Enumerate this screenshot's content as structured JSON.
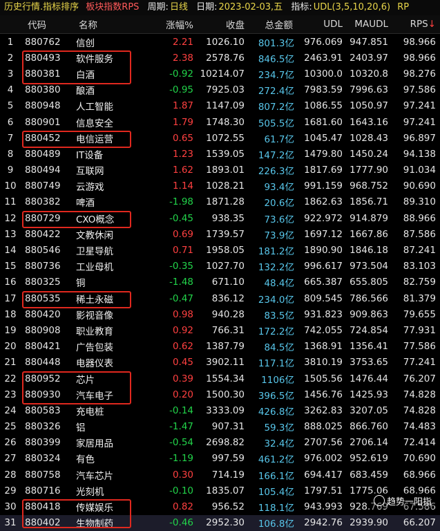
{
  "topbar": {
    "title": "历史行情.指标排序",
    "sub": "板块指数RPS",
    "period_label": "周期:",
    "period_value": "日线",
    "date_label": "日期:",
    "date_value": "2023-02-03,五",
    "indicator_label": "指标:",
    "indicator_value": "UDL(3,5,10,20,6)",
    "extra": "RP"
  },
  "headers": {
    "index": "",
    "code": "代码",
    "name": "名称",
    "change": "涨幅%",
    "close": "收盘",
    "amount": "总金额",
    "udl": "UDL",
    "maudl": "MAUDL",
    "rps": "RPS",
    "sort_arrow": "↓"
  },
  "rows": [
    {
      "n": "1",
      "code": "880762",
      "name": "信创",
      "chg": "2.21",
      "close": "1026.10",
      "amt": "801.3亿",
      "udl": "976.069",
      "maudl": "947.851",
      "rps": "98.966"
    },
    {
      "n": "2",
      "code": "880493",
      "name": "软件服务",
      "chg": "2.38",
      "close": "2578.76",
      "amt": "846.5亿",
      "udl": "2463.91",
      "maudl": "2403.97",
      "rps": "98.966"
    },
    {
      "n": "3",
      "code": "880381",
      "name": "白酒",
      "chg": "-0.92",
      "close": "10214.07",
      "amt": "234.7亿",
      "udl": "10300.0",
      "maudl": "10320.8",
      "rps": "98.276"
    },
    {
      "n": "4",
      "code": "880380",
      "name": "酿酒",
      "chg": "-0.95",
      "close": "7925.03",
      "amt": "272.4亿",
      "udl": "7983.59",
      "maudl": "7996.63",
      "rps": "97.586"
    },
    {
      "n": "5",
      "code": "880948",
      "name": "人工智能",
      "chg": "1.87",
      "close": "1147.09",
      "amt": "807.2亿",
      "udl": "1086.55",
      "maudl": "1050.97",
      "rps": "97.241"
    },
    {
      "n": "6",
      "code": "880901",
      "name": "信息安全",
      "chg": "1.79",
      "close": "1748.30",
      "amt": "505.5亿",
      "udl": "1681.60",
      "maudl": "1643.16",
      "rps": "97.241"
    },
    {
      "n": "7",
      "code": "880452",
      "name": "电信运营",
      "chg": "0.65",
      "close": "1072.55",
      "amt": "61.7亿",
      "udl": "1045.47",
      "maudl": "1028.43",
      "rps": "96.897"
    },
    {
      "n": "8",
      "code": "880489",
      "name": "IT设备",
      "chg": "1.23",
      "close": "1539.05",
      "amt": "147.2亿",
      "udl": "1479.80",
      "maudl": "1450.24",
      "rps": "94.138"
    },
    {
      "n": "9",
      "code": "880494",
      "name": "互联网",
      "chg": "1.62",
      "close": "1893.01",
      "amt": "226.3亿",
      "udl": "1817.69",
      "maudl": "1777.90",
      "rps": "91.034"
    },
    {
      "n": "10",
      "code": "880749",
      "name": "云游戏",
      "chg": "1.14",
      "close": "1028.21",
      "amt": "93.4亿",
      "udl": "991.159",
      "maudl": "968.752",
      "rps": "90.690"
    },
    {
      "n": "11",
      "code": "880382",
      "name": "啤酒",
      "chg": "-1.98",
      "close": "1871.28",
      "amt": "20.6亿",
      "udl": "1862.63",
      "maudl": "1856.71",
      "rps": "89.310"
    },
    {
      "n": "12",
      "code": "880729",
      "name": "CXO概念",
      "chg": "-0.45",
      "close": "938.35",
      "amt": "73.6亿",
      "udl": "922.972",
      "maudl": "914.879",
      "rps": "88.966"
    },
    {
      "n": "13",
      "code": "880422",
      "name": "文教休闲",
      "chg": "0.69",
      "close": "1739.57",
      "amt": "73.9亿",
      "udl": "1697.12",
      "maudl": "1667.86",
      "rps": "87.586"
    },
    {
      "n": "14",
      "code": "880546",
      "name": "卫星导航",
      "chg": "0.71",
      "close": "1958.05",
      "amt": "181.2亿",
      "udl": "1890.90",
      "maudl": "1846.18",
      "rps": "87.241"
    },
    {
      "n": "15",
      "code": "880736",
      "name": "工业母机",
      "chg": "-0.35",
      "close": "1027.70",
      "amt": "132.2亿",
      "udl": "996.617",
      "maudl": "973.504",
      "rps": "83.103"
    },
    {
      "n": "16",
      "code": "880325",
      "name": "铜",
      "chg": "-1.48",
      "close": "671.10",
      "amt": "48.4亿",
      "udl": "665.387",
      "maudl": "655.805",
      "rps": "82.759"
    },
    {
      "n": "17",
      "code": "880535",
      "name": "稀土永磁",
      "chg": "-0.47",
      "close": "836.12",
      "amt": "234.0亿",
      "udl": "809.545",
      "maudl": "786.566",
      "rps": "81.379"
    },
    {
      "n": "18",
      "code": "880420",
      "name": "影视音像",
      "chg": "0.98",
      "close": "940.28",
      "amt": "83.5亿",
      "udl": "931.823",
      "maudl": "909.863",
      "rps": "79.655"
    },
    {
      "n": "19",
      "code": "880908",
      "name": "职业教育",
      "chg": "0.92",
      "close": "766.31",
      "amt": "172.2亿",
      "udl": "742.055",
      "maudl": "724.854",
      "rps": "77.931"
    },
    {
      "n": "20",
      "code": "880421",
      "name": "广告包装",
      "chg": "0.62",
      "close": "1387.79",
      "amt": "84.5亿",
      "udl": "1368.91",
      "maudl": "1356.41",
      "rps": "77.586"
    },
    {
      "n": "21",
      "code": "880448",
      "name": "电器仪表",
      "chg": "0.45",
      "close": "3902.11",
      "amt": "117.1亿",
      "udl": "3810.19",
      "maudl": "3753.65",
      "rps": "77.241"
    },
    {
      "n": "22",
      "code": "880952",
      "name": "芯片",
      "chg": "0.39",
      "close": "1554.34",
      "amt": "1106亿",
      "udl": "1505.56",
      "maudl": "1476.44",
      "rps": "76.207"
    },
    {
      "n": "23",
      "code": "880930",
      "name": "汽车电子",
      "chg": "0.20",
      "close": "1500.30",
      "amt": "396.5亿",
      "udl": "1456.76",
      "maudl": "1425.93",
      "rps": "74.828"
    },
    {
      "n": "24",
      "code": "880583",
      "name": "充电桩",
      "chg": "-0.14",
      "close": "3333.09",
      "amt": "426.8亿",
      "udl": "3262.83",
      "maudl": "3207.05",
      "rps": "74.828"
    },
    {
      "n": "25",
      "code": "880326",
      "name": "铝",
      "chg": "-1.47",
      "close": "907.31",
      "amt": "59.3亿",
      "udl": "888.025",
      "maudl": "866.760",
      "rps": "74.483"
    },
    {
      "n": "26",
      "code": "880399",
      "name": "家居用品",
      "chg": "-0.54",
      "close": "2698.82",
      "amt": "32.4亿",
      "udl": "2707.56",
      "maudl": "2706.14",
      "rps": "72.414"
    },
    {
      "n": "27",
      "code": "880324",
      "name": "有色",
      "chg": "-1.19",
      "close": "997.59",
      "amt": "461.2亿",
      "udl": "976.002",
      "maudl": "952.619",
      "rps": "70.690"
    },
    {
      "n": "28",
      "code": "880758",
      "name": "汽车芯片",
      "chg": "0.30",
      "close": "714.19",
      "amt": "166.1亿",
      "udl": "694.417",
      "maudl": "683.459",
      "rps": "68.966"
    },
    {
      "n": "29",
      "code": "880716",
      "name": "光刻机",
      "chg": "-0.10",
      "close": "1835.07",
      "amt": "105.4亿",
      "udl": "1797.51",
      "maudl": "1775.06",
      "rps": "68.966"
    },
    {
      "n": "30",
      "code": "880418",
      "name": "传媒娱乐",
      "chg": "0.82",
      "close": "956.52",
      "amt": "118.1亿",
      "udl": "943.993",
      "maudl": "928.769",
      "rps": "67.586"
    },
    {
      "n": "31",
      "code": "880402",
      "name": "生物制药",
      "chg": "-0.46",
      "close": "2952.30",
      "amt": "106.8亿",
      "udl": "2942.76",
      "maudl": "2939.90",
      "rps": "66.207"
    }
  ],
  "highlight_rows": [
    2,
    3,
    7,
    12,
    17,
    22,
    23,
    30,
    31
  ],
  "watermark": "趋势一阳指"
}
